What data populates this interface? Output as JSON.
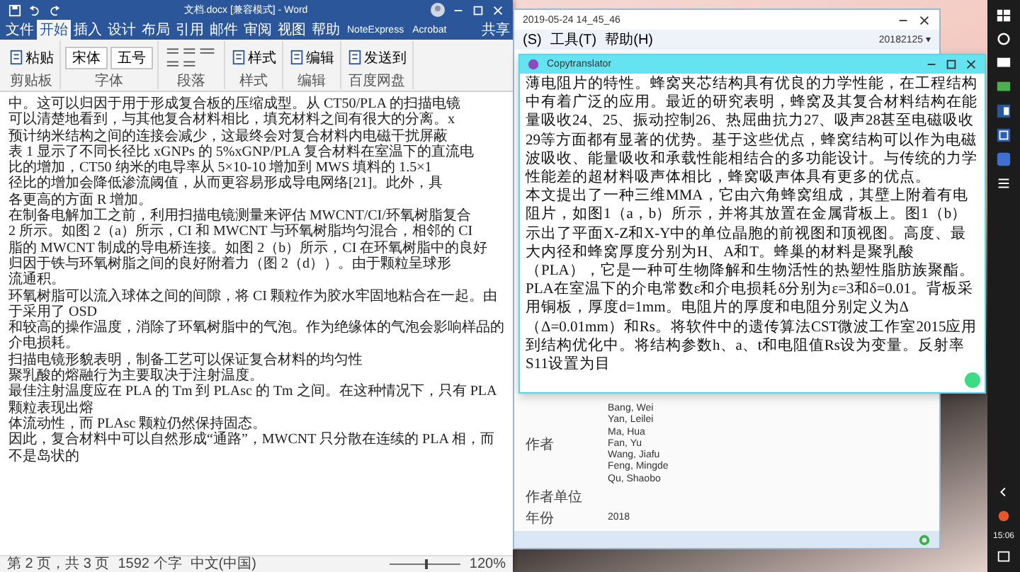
{
  "word": {
    "title": "文档.docx [兼容模式] - Word",
    "tabs": [
      {
        "label": "文件",
        "selected": false
      },
      {
        "label": "开始",
        "selected": true
      },
      {
        "label": "插入",
        "selected": false
      },
      {
        "label": "设计",
        "selected": false
      },
      {
        "label": "布局",
        "selected": false
      },
      {
        "label": "引用",
        "selected": false
      },
      {
        "label": "邮件",
        "selected": false
      },
      {
        "label": "审阅",
        "selected": false
      },
      {
        "label": "视图",
        "selected": false
      },
      {
        "label": "帮助",
        "selected": false
      },
      {
        "label": "NoteExpress",
        "selected": false
      },
      {
        "label": "Acrobat",
        "selected": false
      }
    ],
    "share": "共享",
    "ribbon": [
      {
        "label": "剪贴板",
        "items": [
          {
            "kind": "button",
            "label": "粘贴"
          }
        ]
      },
      {
        "label": "字体",
        "items": [
          {
            "kind": "field",
            "value": "宋体"
          },
          {
            "kind": "field",
            "value": "五号"
          }
        ]
      },
      {
        "label": "段落",
        "items": [
          {
            "kind": "tools"
          }
        ]
      },
      {
        "label": "样式",
        "items": [
          {
            "kind": "button",
            "label": "样式"
          }
        ]
      },
      {
        "label": "编辑",
        "items": [
          {
            "kind": "button",
            "label": "编辑"
          }
        ]
      },
      {
        "label": "百度网盘",
        "items": [
          {
            "kind": "button",
            "label": "发送到"
          }
        ]
      }
    ],
    "lines": [
      "中。这可以归因于用于形成复合板的压缩成型。从 CT50/PLA 的扫描电镜",
      "可以清楚地看到，与其他复合材料相比，填充材料之间有很大的分离。x",
      "预计纳米结构之间的连接会减少，这最终会对复合材料内电磁干扰屏蔽",
      "表 1 显示了不同长径比 xGNPs 的 5%xGNP/PLA 复合材料在室温下的直流电",
      "比的增加，CT50 纳米的电导率从 5×10-10 增加到 MWS 填料的 1.5×1",
      "径比的增加会降低渗流阈值，从而更容易形成导电网络[21]。此外，具",
      "各更高的方面 R 增加。",
      "在制备电解加工之前，利用扫描电镜测量来评估 MWCNT/CI/环氧树脂复合",
      "2 所示。如图 2（a）所示，CI 和 MWCNT 与环氧树脂均匀混合，相邻的 CI",
      "脂的 MWCNT 制成的导电桥连接。如图 2（b）所示，CI 在环氧树脂中的良好",
      "归因于铁与环氧树脂之间的良好附着力（图 2（d））。由于颗粒呈球形",
      "流通积。",
      "环氧树脂可以流入球体之间的间隙，将 CI 颗粒作为胶水牢固地粘合在一起。由于采用了 OSD",
      "和较高的操作温度，消除了环氧树脂中的气泡。作为绝缘体的气泡会影响样品的介电损耗。",
      "扫描电镜形貌表明，制备工艺可以保证复合材料的均匀性",
      "聚乳酸的熔融行为主要取决于注射温度。",
      "最佳注射温度应在 PLA 的 Tm 到 PLAsc 的 Tm 之间。在这种情况下，只有 PLA 颗粒表现出熔",
      "体流动性，而 PLAsc 颗粒仍然保持固态。",
      "因此，复合材料中可以自然形成“通路”，MWCNT 只分散在连续的 PLA 相，而不是岛状的"
    ],
    "status": {
      "page": "第 2 页，共 3 页",
      "words": "1592 个字",
      "language": "中文(中国)",
      "zoom": "120%",
      "zoom_slider": {
        "level": 0.5
      }
    }
  },
  "noteexpress": {
    "title": "2019-05-24 14_45_46",
    "menu": [
      "(S)",
      "工具(T)",
      "帮助(H)"
    ],
    "user": "20182125 ▾",
    "fields": [
      {
        "label": "作者",
        "values": [
          "Bang, Wei",
          "Yan, Leilei",
          "Ma, Hua",
          "Fan, Yu",
          "Wang, Jiafu",
          "Feng, Mingde",
          "Qu, Shaobo"
        ]
      },
      {
        "label": "作者单位"
      },
      {
        "label": "年份",
        "values": [
          "2018"
        ]
      }
    ]
  },
  "translator": {
    "title": "Copytranslator",
    "paragraphs": [
      "薄电阻片的特性。蜂窝夹芯结构具有优良的力学性能，在工程结构中有着广泛的应用。最近的研究表明，蜂窝及其复合材料结构在能量吸收24、25、振动控制26、热屈曲抗力27、吸声28甚至电磁吸收29等方面都有显著的优势。基于这些优点，蜂窝结构可以作为电磁波吸收、能量吸收和承载性能相结合的多功能设计。与传统的力学性能差的超材料吸声体相比，蜂窝吸声体具有更多的优点。",
      "本文提出了一种三维MMA，它由六角蜂窝组成，其壁上附着有电阻片，如图1（a，b）所示，并将其放置在金属背板上。图1（b）示出了平面X-Z和X-Y中的单位晶胞的前视图和顶视图。高度、最大内径和蜂窝厚度分别为H、A和T。蜂巢的材料是聚乳酸（PLA），它是一种可生物降解和生物活性的热塑性脂肪族聚酯。PLA在室温下的介电常数ε和介电损耗δ分别为ε=3和δ=0.01。背板采用铜板，厚度d=1mm。电阻片的厚度和电阻分别定义为Δ（Δ=0.01mm）和Rs。将软件中的遗传算法CST微波工作室2015应用到结构优化中。将结构参数h、a、t和电阻值Rs设为变量。反射率S11设置为目"
    ]
  },
  "taskbar": {
    "time": "15:06"
  }
}
